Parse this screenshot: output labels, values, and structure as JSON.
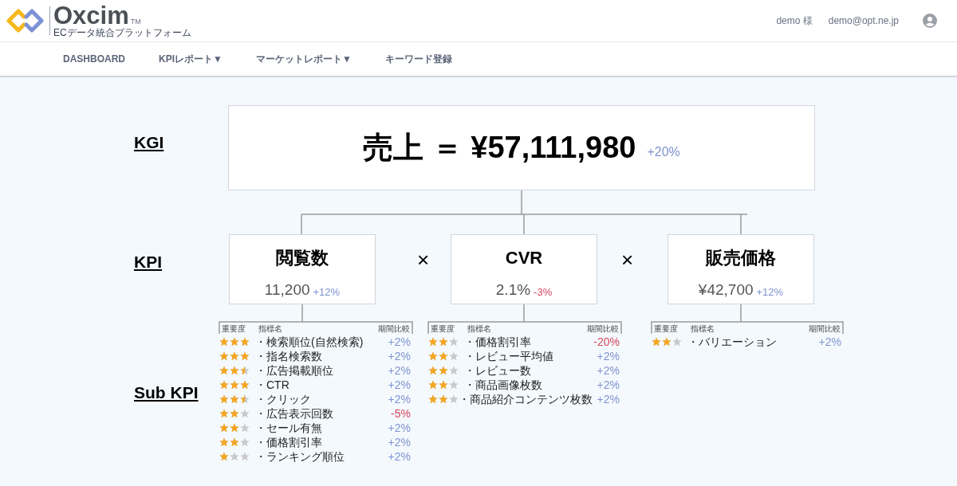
{
  "header": {
    "logo": "Oxcim",
    "trademark": "TM",
    "tagline": "ECデータ統合プラットフォーム",
    "user_name": "demo 様",
    "email": "demo@opt.ne.jp"
  },
  "nav": [
    {
      "label": "DASHBOARD"
    },
    {
      "label": "KPIレポート▼"
    },
    {
      "label": "マーケットレポート▼"
    },
    {
      "label": "キーワード登録"
    }
  ],
  "levels": [
    "KGI",
    "KPI",
    "Sub KPI"
  ],
  "kgi": {
    "label": "売上 ＝ ¥57,111,980",
    "change": "+20%",
    "color": "#7f93cf"
  },
  "operators": [
    "×",
    "×"
  ],
  "kpis": [
    {
      "title": "閲覧数",
      "value": "11,200",
      "change": "+12%",
      "color": "#7f93cf",
      "columns": [
        "重要度",
        "指標名",
        "期間比較"
      ],
      "rows": [
        {
          "stars": 3,
          "name": "・検索順位(自然検索)",
          "change": "+2%",
          "color": "#7f93cf"
        },
        {
          "stars": 3,
          "name": "・指名検索数",
          "change": "+2%",
          "color": "#7f93cf"
        },
        {
          "stars": 2.5,
          "name": "・広告掲載順位",
          "change": "+2%",
          "color": "#7f93cf"
        },
        {
          "stars": 3,
          "name": "・CTR",
          "change": "+2%",
          "color": "#7f93cf"
        },
        {
          "stars": 2.5,
          "name": "・クリック",
          "change": "+2%",
          "color": "#7f93cf"
        },
        {
          "stars": 2,
          "name": "・広告表示回数",
          "change": "-5%",
          "color": "#d6455c"
        },
        {
          "stars": 2,
          "name": "・セール有無",
          "change": "+2%",
          "color": "#7f93cf"
        },
        {
          "stars": 2,
          "name": "・価格割引率",
          "change": "+2%",
          "color": "#7f93cf"
        },
        {
          "stars": 1,
          "name": "・ランキング順位",
          "change": "+2%",
          "color": "#7f93cf"
        }
      ]
    },
    {
      "title": "CVR",
      "value": "2.1%",
      "change": "-3%",
      "color": "#d6455c",
      "columns": [
        "重要度",
        "指標名",
        "期間比較"
      ],
      "rows": [
        {
          "stars": 2,
          "name": "・価格割引率",
          "change": "-20%",
          "color": "#d6455c"
        },
        {
          "stars": 2,
          "name": "・レビュー平均値",
          "change": "+2%",
          "color": "#7f93cf"
        },
        {
          "stars": 2,
          "name": "・レビュー数",
          "change": "+2%",
          "color": "#7f93cf"
        },
        {
          "stars": 2,
          "name": "・商品画像枚数",
          "change": "+2%",
          "color": "#7f93cf"
        },
        {
          "stars": 2,
          "name": "・商品紹介コンテンツ枚数",
          "change": "+2%",
          "color": "#7f93cf"
        }
      ]
    },
    {
      "title": "販売価格",
      "value": "¥42,700",
      "change": "+12%",
      "color": "#7f93cf",
      "columns": [
        "重要度",
        "指標名",
        "期間比較"
      ],
      "rows": [
        {
          "stars": 2,
          "name": "・バリエーション",
          "change": "+2%",
          "color": "#7f93cf"
        }
      ]
    }
  ]
}
